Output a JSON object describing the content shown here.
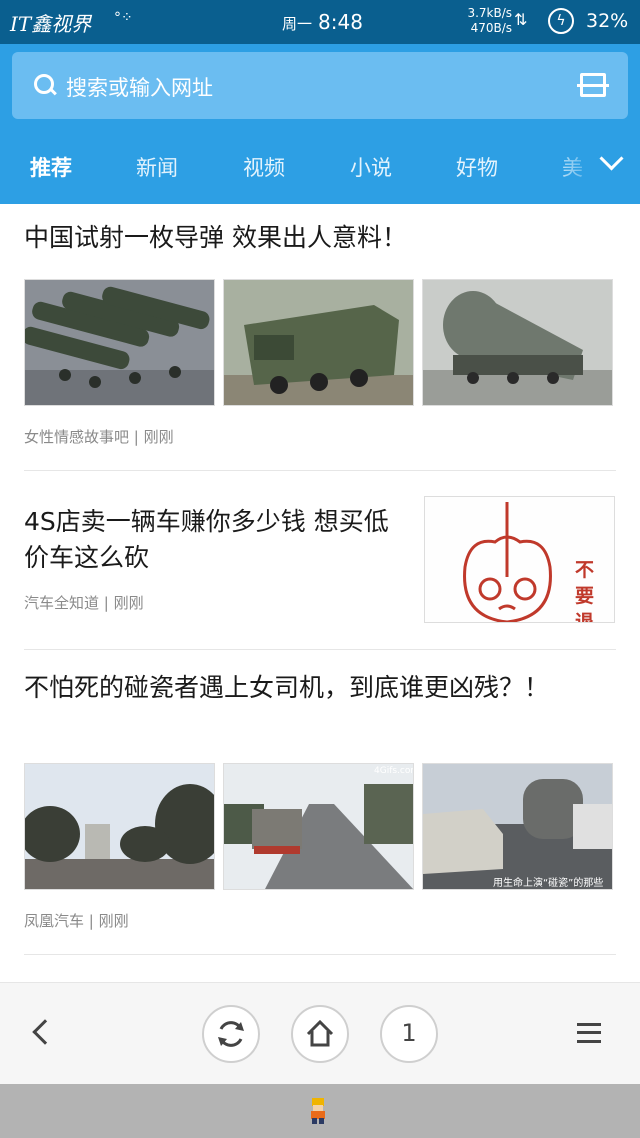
{
  "status_bar": {
    "brand": "IT鑫视界",
    "weekday": "周一",
    "time": "8:48",
    "net_up": "3.7kB/s",
    "net_down": "470B/s",
    "battery": "32%"
  },
  "search": {
    "placeholder": "搜索或输入网址"
  },
  "tabs": [
    {
      "label": "推荐",
      "active": true
    },
    {
      "label": "新闻"
    },
    {
      "label": "视频"
    },
    {
      "label": "小说"
    },
    {
      "label": "好物"
    },
    {
      "label": "美"
    }
  ],
  "feed": [
    {
      "title": "中国试射一枚导弹 效果出人意料！",
      "source": "女性情感故事吧",
      "time": "刚刚",
      "images": [
        "missile-trucks-parade",
        "missile-launcher-truck",
        "missile-on-transporter"
      ]
    },
    {
      "title": "4S店卖一辆车赚你多少钱 想买低价车这么砍",
      "source": "汽车全知道",
      "time": "刚刚",
      "images": [
        "cartoon-bunny-sticker"
      ],
      "image_text": "不要退"
    },
    {
      "title": "不怕死的碰瓷者遇上女司机，到底谁更凶残？！",
      "source": "凤凰汽车",
      "time": "刚刚",
      "images": [
        "street-scene",
        "truck-on-road",
        "car-and-tanker"
      ],
      "image_captions": [
        "",
        "4Gifs.com",
        "用生命上演“碰瓷”的那些"
      ]
    }
  ],
  "bottom_bar": {
    "tab_count": "1"
  },
  "colors": {
    "status_bar": "#0a5f8f",
    "header": "#2d9fe4",
    "search_box": "#6bbdf1"
  }
}
